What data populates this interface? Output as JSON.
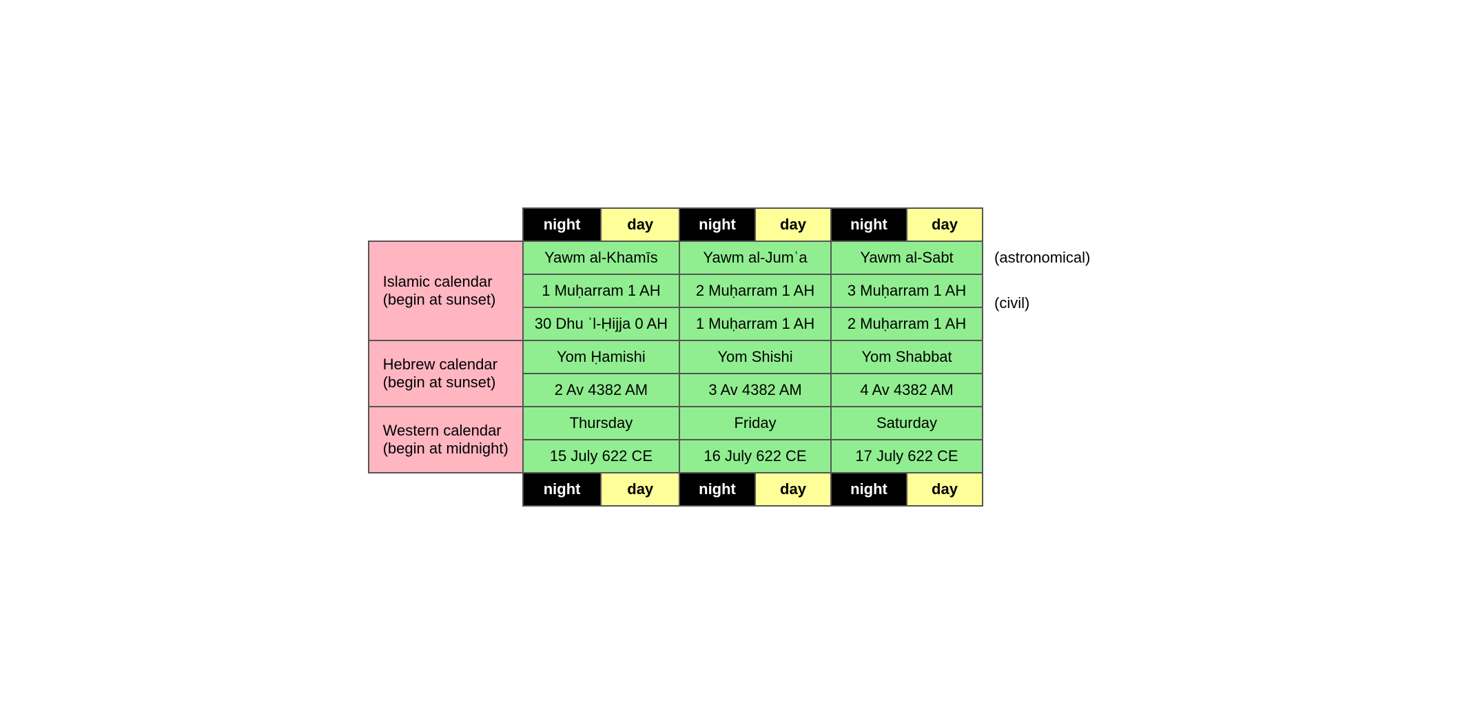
{
  "header": {
    "night": "night",
    "day": "day"
  },
  "islamic": {
    "label_line1": "Islamic calendar",
    "label_line2": "(begin at sunset)",
    "day1_name": "Yawm al-Khamīs",
    "day2_name": "Yawm al-Jumʿa",
    "day3_name": "Yawm al-Sabt",
    "day1_astro": "1 Muḥarram 1 AH",
    "day2_astro": "2 Muḥarram 1 AH",
    "day3_astro": "3 Muḥarram 1 AH",
    "day1_civil": "30 Dhu ʾl-Ḥijja 0 AH",
    "day2_civil": "1 Muḥarram 1 AH",
    "day3_civil": "2 Muḥarram 1 AH",
    "note_astro": "(astronomical)",
    "note_civil": "(civil)"
  },
  "hebrew": {
    "label_line1": "Hebrew calendar",
    "label_line2": "(begin at sunset)",
    "day1_name": "Yom Ḥamishi",
    "day2_name": "Yom Shishi",
    "day3_name": "Yom Shabbat",
    "day1_date": "2 Av 4382 AM",
    "day2_date": "3 Av 4382 AM",
    "day3_date": "4 Av 4382 AM"
  },
  "western": {
    "label_line1": "Western calendar",
    "label_line2": "(begin at midnight)",
    "day1_name": "Thursday",
    "day2_name": "Friday",
    "day3_name": "Saturday",
    "day1_date": "15 July 622 CE",
    "day2_date": "16 July 622 CE",
    "day3_date": "17 July 622 CE"
  }
}
